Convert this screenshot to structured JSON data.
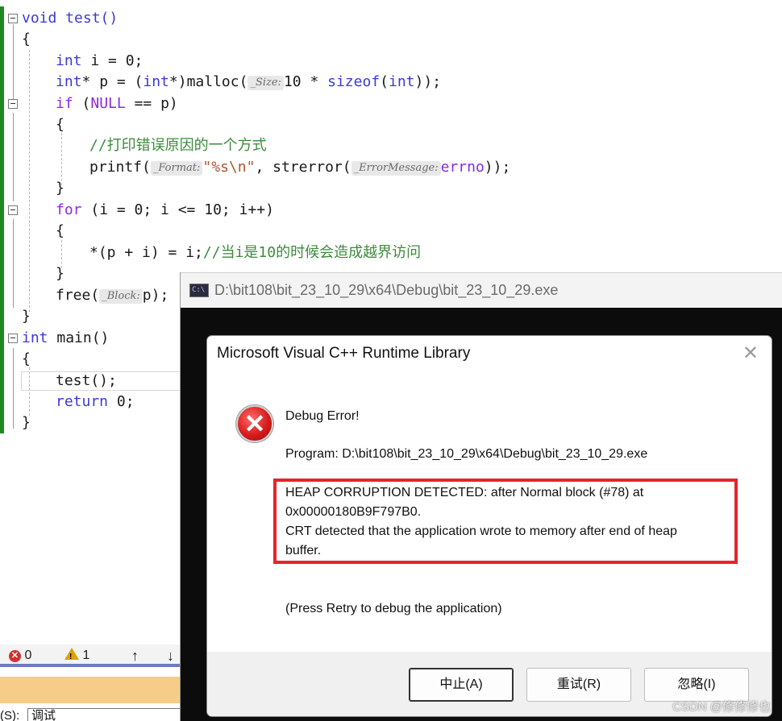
{
  "editor": {
    "lines": [
      {
        "fold": true,
        "html_key": "l1"
      },
      {
        "fold": false,
        "html_key": "l2"
      }
    ],
    "code": {
      "l01": "void test()",
      "l02": "{",
      "l03_a": "int",
      "l03_b": " i = 0;",
      "l04_a": "int",
      "l04_b": "* p = (",
      "l04_c": "int",
      "l04_d": "*)malloc(",
      "l04_hint": "_Size:",
      "l04_e": "10 * ",
      "l04_f": "sizeof",
      "l04_g": "(",
      "l04_h": "int",
      "l04_i": "));",
      "l05_a": "if",
      "l05_b": " (",
      "l05_c": "NULL",
      "l05_d": " == p)",
      "l06": "{",
      "l07": "//打印错误原因的一个方式",
      "l08_a": "printf(",
      "l08_hint": "_Format:",
      "l08_str": "\"%s\\n\"",
      "l08_b": ", strerror(",
      "l08_hint2": "_ErrorMessage:",
      "l08_c": "errno",
      "l08_d": "));",
      "l09": "}",
      "l10_a": "for",
      "l10_b": " (i = 0; i <= 10; i++)",
      "l11": "{",
      "l12_a": "*(p + i) = i;",
      "l12_cm": "//当i是10的时候会造成越界访问",
      "l13": "}",
      "l14_a": "free(",
      "l14_hint": "_Block:",
      "l14_b": "p);",
      "l15": "}",
      "l16_a": "int",
      "l16_b": " main()",
      "l17": "{",
      "l18": "test();",
      "l19_a": "return",
      "l19_b": " 0;",
      "l20": "}"
    }
  },
  "status": {
    "errors": "0",
    "warnings": "1",
    "up_arrow": "↑",
    "down_arrow": "↓",
    "search_label": "(S):",
    "search_value": "调试"
  },
  "console": {
    "icon_text": "C:\\",
    "title": "D:\\bit108\\bit_23_10_29\\x64\\Debug\\bit_23_10_29.exe"
  },
  "dialog": {
    "title": "Microsoft Visual C++ Runtime Library",
    "close": "✕",
    "heading": "Debug Error!",
    "program": "Program: D:\\bit108\\bit_23_10_29\\x64\\Debug\\bit_23_10_29.exe",
    "msg1": "HEAP CORRUPTION DETECTED: after Normal block (#78) at",
    "msg2": "0x00000180B9F797B0.",
    "msg3": "CRT detected that the application wrote to memory after end of heap",
    "msg4": "buffer.",
    "hint": "(Press Retry to debug the application)",
    "buttons": {
      "abort": "中止(A)",
      "retry": "重试(R)",
      "ignore": "忽略(I)"
    },
    "highlight_color": "#e8232a"
  },
  "watermark": "CSDN @修修修也"
}
